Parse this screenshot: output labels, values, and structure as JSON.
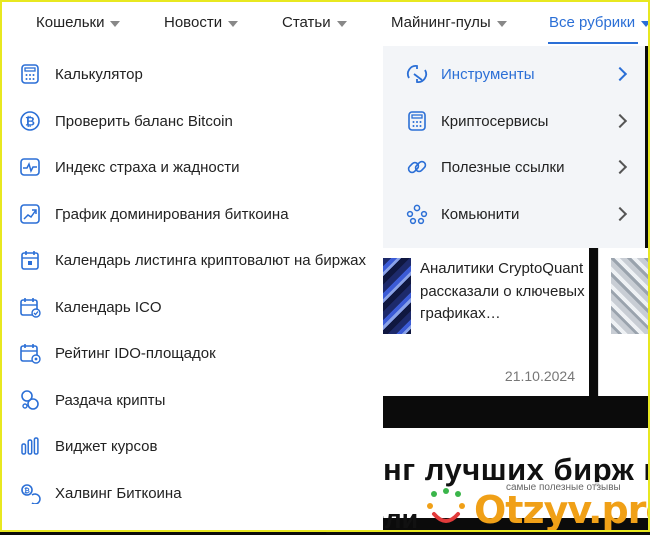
{
  "nav": {
    "items": [
      {
        "label": "Кошельки"
      },
      {
        "label": "Новости"
      },
      {
        "label": "Статьи"
      },
      {
        "label": "Майнинг-пулы"
      },
      {
        "label": "Все рубрики"
      }
    ],
    "active_index": 4,
    "accent_color": "#2b6fd6"
  },
  "tools_menu": {
    "items": [
      {
        "label": "Калькулятор",
        "icon": "calculator-icon"
      },
      {
        "label": "Проверить баланс Bitcoin",
        "icon": "bitcoin-icon"
      },
      {
        "label": "Индекс страха и жадности",
        "icon": "pulse-chart-icon"
      },
      {
        "label": "График доминирования биткоина",
        "icon": "growth-chart-icon"
      },
      {
        "label": "Календарь листинга криптовалют на биржах",
        "icon": "calendar-icon"
      },
      {
        "label": "Календарь ICO",
        "icon": "calendar-check-icon"
      },
      {
        "label": "Рейтинг IDO-площадок",
        "icon": "calendar-rating-icon"
      },
      {
        "label": "Раздача крипты",
        "icon": "coins-icon"
      },
      {
        "label": "Виджет курсов",
        "icon": "bar-chart-icon"
      },
      {
        "label": "Халвинг Биткоина",
        "icon": "halving-icon"
      }
    ]
  },
  "categories": {
    "items": [
      {
        "label": "Инструменты",
        "icon": "tools-icon"
      },
      {
        "label": "Криптосервисы",
        "icon": "calculator-icon"
      },
      {
        "label": "Полезные ссылки",
        "icon": "link-icon"
      },
      {
        "label": "Комьюнити",
        "icon": "community-icon"
      }
    ],
    "active_index": 0
  },
  "article": {
    "title": "Аналитики CryptoQuant рассказали о ключевых графиках…",
    "date": "21.10.2024"
  },
  "headline": {
    "line1": "нг лучших бирж кр",
    "line2": "торговли"
  },
  "watermark": {
    "tagline": "самые полезные отзывы",
    "logo": "Otzyv.pro"
  }
}
